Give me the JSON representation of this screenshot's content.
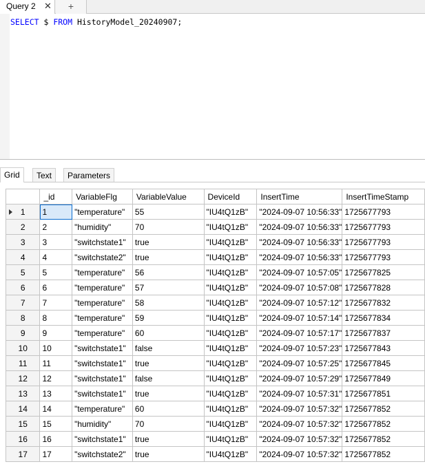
{
  "query_tab": {
    "label": "Query 2",
    "close_glyph": "✕",
    "new_tab_glyph": "+"
  },
  "editor": {
    "sql_tokens": [
      {
        "text": "SELECT",
        "kind": "keyword"
      },
      {
        "text": " $ ",
        "kind": "text"
      },
      {
        "text": "FROM",
        "kind": "keyword"
      },
      {
        "text": " HistoryModel_20240907;",
        "kind": "text"
      }
    ]
  },
  "result_tabs": [
    {
      "label": "Grid",
      "active": true
    },
    {
      "label": "Text",
      "active": false
    },
    {
      "label": "Parameters",
      "active": false
    }
  ],
  "grid": {
    "columns": [
      "_id",
      "VariableFlg",
      "VariableValue",
      "DeviceId",
      "InsertTime",
      "InsertTimeStamp"
    ],
    "rows": [
      [
        "1",
        "1",
        "\"temperature\"",
        "55",
        "\"IU4tQ1zB\"",
        "\"2024-09-07 10:56:33\"",
        "1725677793"
      ],
      [
        "2",
        "2",
        "\"humidity\"",
        "70",
        "\"IU4tQ1zB\"",
        "\"2024-09-07 10:56:33\"",
        "1725677793"
      ],
      [
        "3",
        "3",
        "\"switchstate1\"",
        "true",
        "\"IU4tQ1zB\"",
        "\"2024-09-07 10:56:33\"",
        "1725677793"
      ],
      [
        "4",
        "4",
        "\"switchstate2\"",
        "true",
        "\"IU4tQ1zB\"",
        "\"2024-09-07 10:56:33\"",
        "1725677793"
      ],
      [
        "5",
        "5",
        "\"temperature\"",
        "56",
        "\"IU4tQ1zB\"",
        "\"2024-09-07 10:57:05\"",
        "1725677825"
      ],
      [
        "6",
        "6",
        "\"temperature\"",
        "57",
        "\"IU4tQ1zB\"",
        "\"2024-09-07 10:57:08\"",
        "1725677828"
      ],
      [
        "7",
        "7",
        "\"temperature\"",
        "58",
        "\"IU4tQ1zB\"",
        "\"2024-09-07 10:57:12\"",
        "1725677832"
      ],
      [
        "8",
        "8",
        "\"temperature\"",
        "59",
        "\"IU4tQ1zB\"",
        "\"2024-09-07 10:57:14\"",
        "1725677834"
      ],
      [
        "9",
        "9",
        "\"temperature\"",
        "60",
        "\"IU4tQ1zB\"",
        "\"2024-09-07 10:57:17\"",
        "1725677837"
      ],
      [
        "10",
        "10",
        "\"switchstate1\"",
        "false",
        "\"IU4tQ1zB\"",
        "\"2024-09-07 10:57:23\"",
        "1725677843"
      ],
      [
        "11",
        "11",
        "\"switchstate1\"",
        "true",
        "\"IU4tQ1zB\"",
        "\"2024-09-07 10:57:25\"",
        "1725677845"
      ],
      [
        "12",
        "12",
        "\"switchstate1\"",
        "false",
        "\"IU4tQ1zB\"",
        "\"2024-09-07 10:57:29\"",
        "1725677849"
      ],
      [
        "13",
        "13",
        "\"switchstate1\"",
        "true",
        "\"IU4tQ1zB\"",
        "\"2024-09-07 10:57:31\"",
        "1725677851"
      ],
      [
        "14",
        "14",
        "\"temperature\"",
        "60",
        "\"IU4tQ1zB\"",
        "\"2024-09-07 10:57:32\"",
        "1725677852"
      ],
      [
        "15",
        "15",
        "\"humidity\"",
        "70",
        "\"IU4tQ1zB\"",
        "\"2024-09-07 10:57:32\"",
        "1725677852"
      ],
      [
        "16",
        "16",
        "\"switchstate1\"",
        "true",
        "\"IU4tQ1zB\"",
        "\"2024-09-07 10:57:32\"",
        "1725677852"
      ],
      [
        "17",
        "17",
        "\"switchstate2\"",
        "true",
        "\"IU4tQ1zB\"",
        "\"2024-09-07 10:57:32\"",
        "1725677852"
      ]
    ],
    "selected_row": 0
  },
  "colors": {
    "keyword": "#0000ff",
    "selection": "#cfe4f7"
  }
}
